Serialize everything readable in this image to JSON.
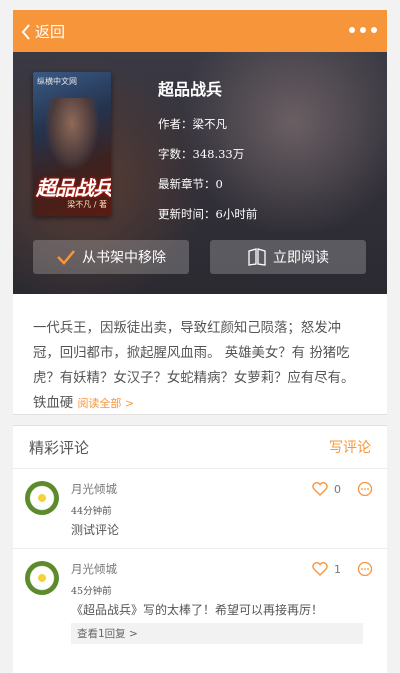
{
  "header": {
    "back_label": "返回"
  },
  "book": {
    "cover_publisher": "纵横中文网",
    "cover_title": "超品战兵",
    "cover_author": "梁不凡 / 著",
    "title": "超品战兵",
    "author_line": "作者：梁不凡",
    "words_line": "字数：348.33万",
    "latest_line": "最新章节：0",
    "update_line": "更新时间：6小时前"
  },
  "actions": {
    "remove_label": "从书架中移除",
    "read_label": "立即阅读"
  },
  "description": {
    "text": "一代兵王，因叛徒出卖，导致红颜知己陨落；怒发冲冠，回归都市，掀起腥风血雨。 英雄美女？有 扮猪吃虎？有妖精？女汉子？女蛇精病？女萝莉？应有尽有。铁血硬",
    "more_label": "阅读全部 >"
  },
  "comments_section": {
    "title": "精彩评论",
    "write_label": "写评论",
    "items": [
      {
        "user": "月光倾城",
        "time": "44分钟前",
        "text": "测试评论",
        "likes": "0"
      },
      {
        "user": "月光倾城",
        "time": "45分钟前",
        "text": "《超品战兵》写的太棒了！希望可以再接再厉！",
        "likes": "1",
        "reply_label": "查看1回复 >"
      }
    ]
  }
}
